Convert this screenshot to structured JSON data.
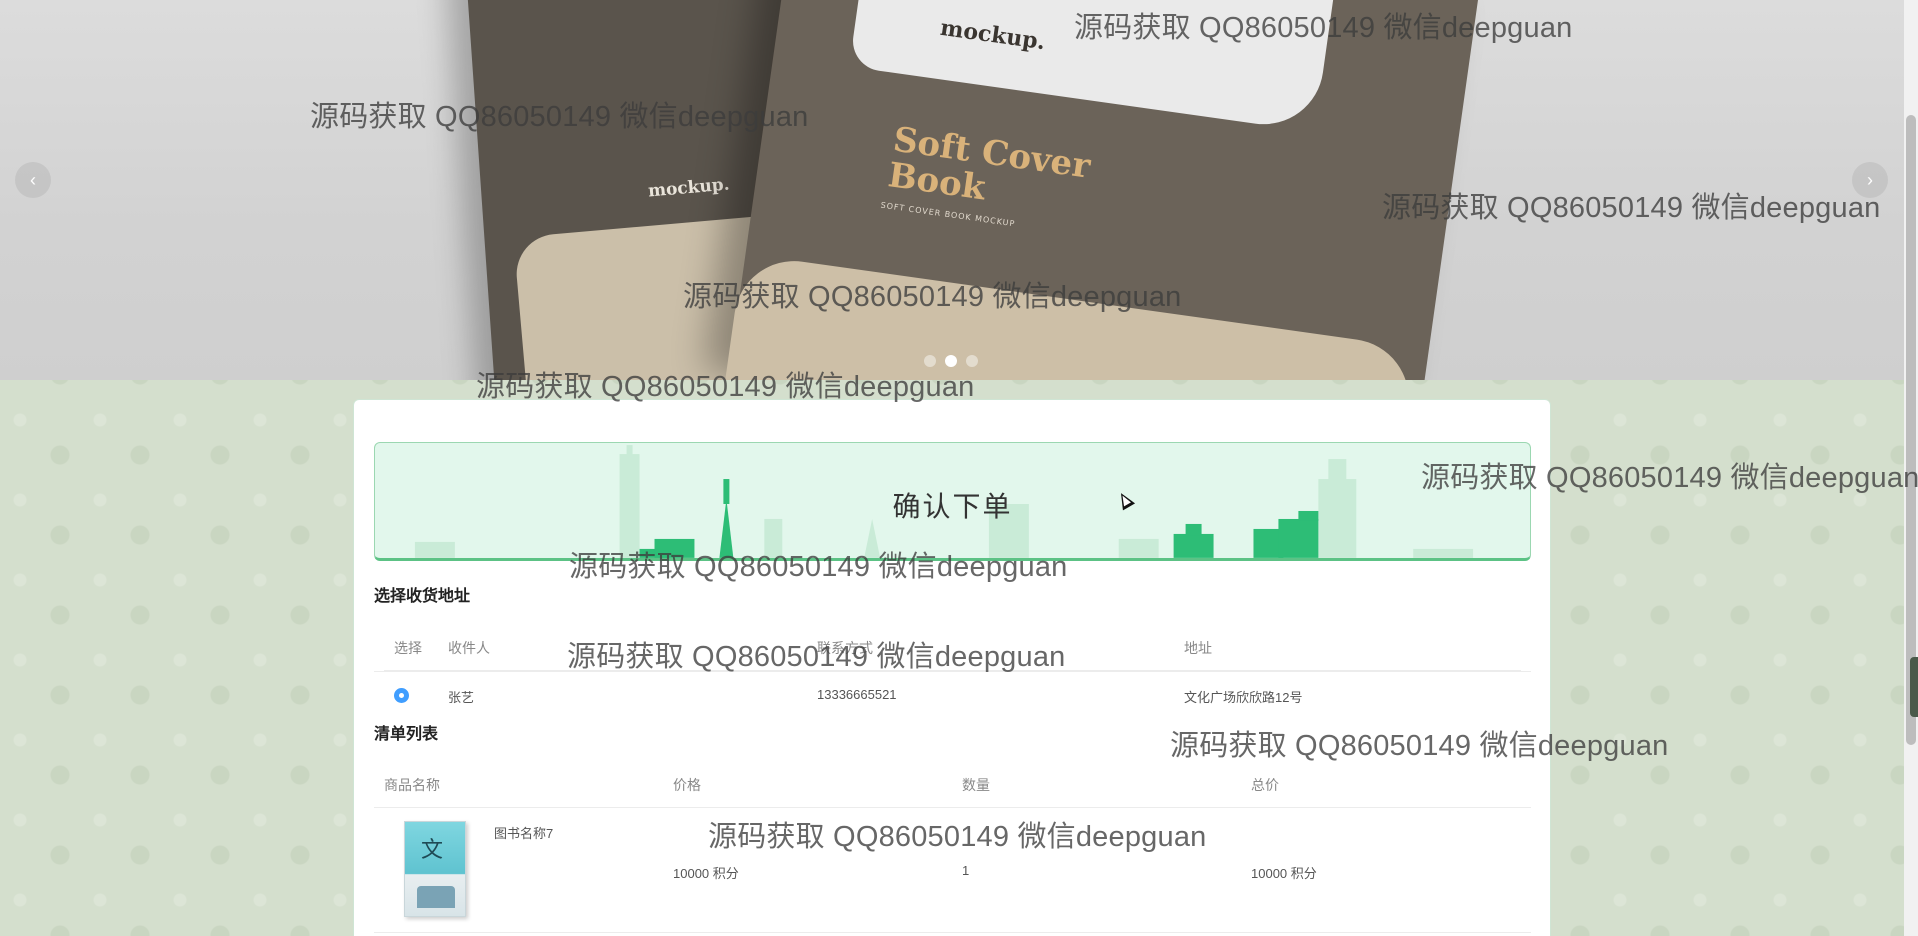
{
  "carousel": {
    "prev_icon": "chevron-left-icon",
    "next_icon": "chevron-right-icon",
    "prev_glyph": "‹",
    "next_glyph": "›",
    "slide_count": 3,
    "active_slide": 2,
    "image": {
      "back_logo": "mockup.",
      "front_logo": "mockup.",
      "front_title_line1": "Soft Cover",
      "front_title_line2": "Book",
      "front_subtitle": "SOFT COVER BOOK MOCKUP"
    }
  },
  "order": {
    "banner_title": "确认下单",
    "address_section_title": "选择收货地址",
    "address_table": {
      "headers": [
        "选择",
        "收件人",
        "联系方式",
        "地址"
      ],
      "rows": [
        {
          "selected": true,
          "recipient": "张艺",
          "phone": "13336665521",
          "address": "文化广场欣欣路12号"
        }
      ]
    },
    "list_section_title": "清单列表",
    "list_table": {
      "headers": [
        "商品名称",
        "价格",
        "数量",
        "总价"
      ],
      "rows": [
        {
          "name": "图书名称7",
          "price": "10000 积分",
          "quantity": "1",
          "total": "10000 积分"
        }
      ]
    }
  },
  "watermark_text": "源码获取 QQ86050149 微信deepguan",
  "colors": {
    "accent_green": "#5cc285",
    "banner_bg": "#e2f7ec",
    "radio_blue": "#409eff",
    "page_bg": "#d4dfcd"
  }
}
